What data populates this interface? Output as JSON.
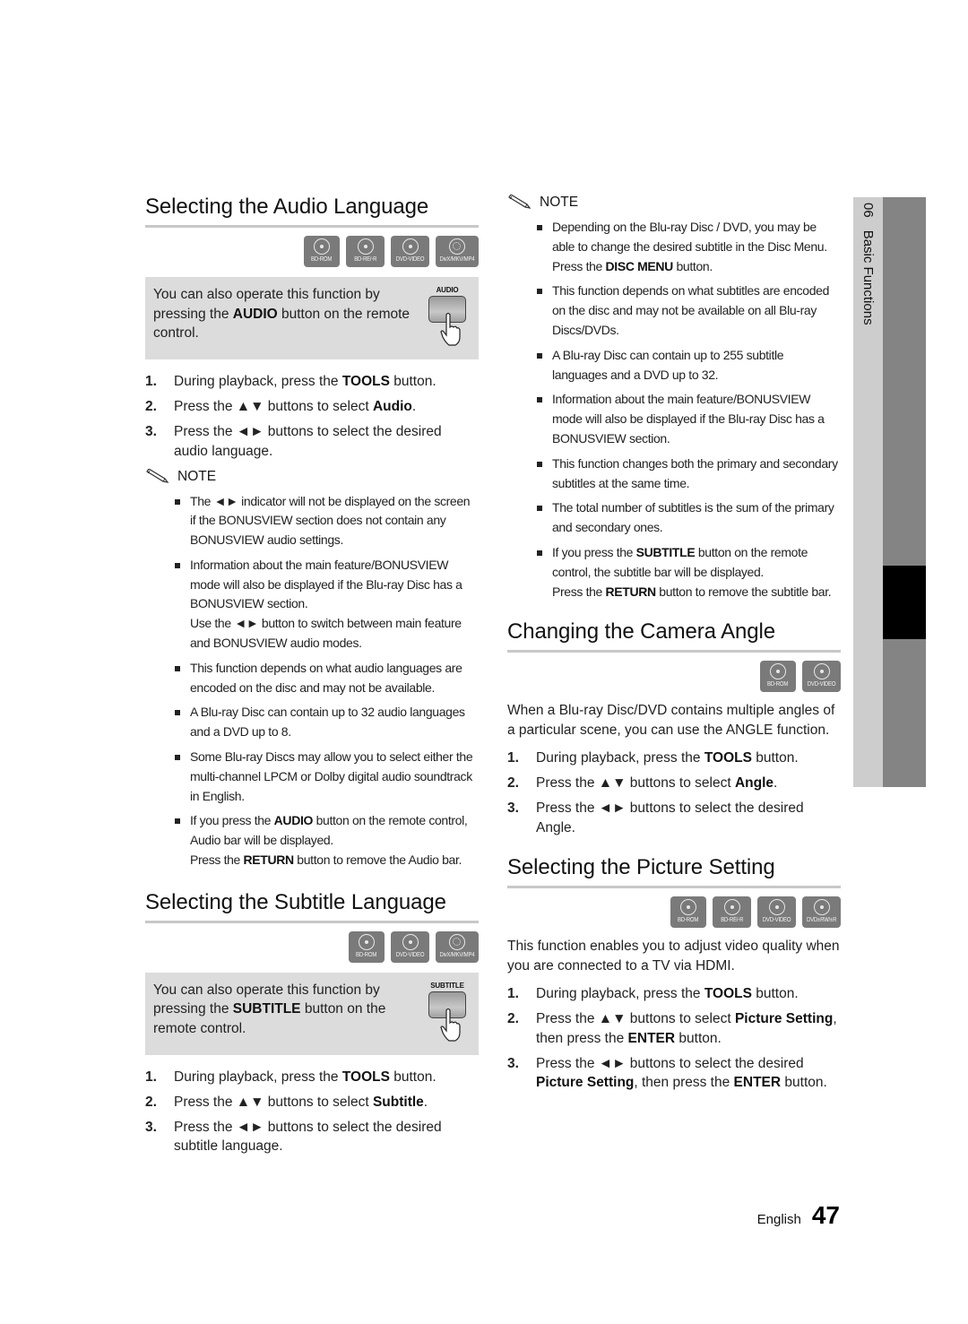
{
  "side_tab": {
    "chapter_number": "06",
    "chapter_title": "Basic Functions"
  },
  "footer": {
    "language": "English",
    "page_number": "47"
  },
  "icons": {
    "note": "pencil-icon",
    "disc": "disc-icon",
    "divx": "film-reel-icon",
    "remote_button": "remote-button-icon",
    "hand": "pointing-hand-icon"
  },
  "colors": {
    "badge_bg": "#7a7a7a",
    "tip_box_bg": "#dcdcdc",
    "rule": "#c8c8c8",
    "side_tab_light": "#cdcdcd",
    "side_tab_dark": "#848484",
    "side_tab_marker": "#000000"
  },
  "audio": {
    "title": "Selecting the Audio Language",
    "badges": [
      "BD-ROM",
      "BD-RE/-R",
      "DVD-VIDEO",
      "DivX/MKV/MP4"
    ],
    "tip": {
      "pre": "You can also operate this function by pressing the ",
      "bold": "AUDIO",
      "post": " button on the remote control.",
      "remote_label": "AUDIO"
    },
    "steps": [
      {
        "num": "1.",
        "pre": "During playback, press the ",
        "bold": "TOOLS",
        "post": " button."
      },
      {
        "num": "2.",
        "pre": "Press the ▲▼ buttons to select ",
        "bold": "Audio",
        "post": "."
      },
      {
        "num": "3.",
        "pre": "Press the ◄► buttons to select the desired audio language.",
        "bold": "",
        "post": ""
      }
    ],
    "note_label": "NOTE",
    "notes": [
      "The ◄► indicator will not be displayed on the screen if the BONUSVIEW section does not contain any BONUSVIEW audio settings.",
      "Information about the main feature/BONUSVIEW mode will also be displayed if the Blu-ray Disc has a BONUSVIEW section.",
      "This function depends on what audio languages are encoded on the disc and may not be available.",
      "A Blu-ray Disc can contain up to 32 audio languages and a DVD up to 8.",
      "Some Blu-ray Discs may allow you to select either the multi-channel LPCM or Dolby digital audio soundtrack in English."
    ],
    "note2_extra": "Use the ◄► button to switch between main feature and BONUSVIEW audio modes.",
    "note_last": {
      "pre": "If you press the ",
      "bold": "AUDIO",
      "post": " button on the remote control, Audio bar will be displayed.",
      "line2_pre": "Press the ",
      "line2_bold": "RETURN",
      "line2_post": " button to remove the Audio bar."
    }
  },
  "subtitle": {
    "title": "Selecting the Subtitle Language",
    "badges": [
      "BD-ROM",
      "DVD-VIDEO",
      "DivX/MKV/MP4"
    ],
    "tip": {
      "pre": "You can also operate this function by pressing the ",
      "bold": "SUBTITLE",
      "post": " button on the remote control.",
      "remote_label": "SUBTITLE"
    },
    "steps": [
      {
        "num": "1.",
        "pre": "During playback, press the ",
        "bold": "TOOLS",
        "post": " button."
      },
      {
        "num": "2.",
        "pre": "Press the ▲▼ buttons to select ",
        "bold": "Subtitle",
        "post": "."
      },
      {
        "num": "3.",
        "pre": "Press the ◄► buttons to select the desired subtitle language.",
        "bold": "",
        "post": ""
      }
    ],
    "note_label": "NOTE",
    "note_first": {
      "pre": "Depending on the Blu-ray Disc / DVD, you may be able to change the desired subtitle in the Disc Menu. Press the ",
      "bold": "DISC MENU",
      "post": " button."
    },
    "notes": [
      "This function depends on what subtitles are encoded on the disc and may not be available on all Blu-ray Discs/DVDs.",
      "A Blu-ray Disc can contain up to 255 subtitle languages and a DVD up to 32.",
      "Information about the main feature/BONUSVIEW mode will also be displayed if the Blu-ray Disc has a BONUSVIEW section.",
      "This function changes both the primary and secondary subtitles at the same time.",
      "The total number of subtitles is the sum of the primary and secondary ones."
    ],
    "note_last": {
      "pre": "If you press the ",
      "bold": "SUBTITLE",
      "post": " button on the remote control, the subtitle bar will be displayed.",
      "line2_pre": "Press the ",
      "line2_bold": "RETURN",
      "line2_post": " button to remove the subtitle bar."
    }
  },
  "angle": {
    "title": "Changing the Camera Angle",
    "badges": [
      "BD-ROM",
      "DVD-VIDEO"
    ],
    "intro": "When a Blu-ray Disc/DVD contains multiple angles of a particular scene, you can use the ANGLE function.",
    "steps": [
      {
        "num": "1.",
        "pre": "During playback, press the ",
        "bold": "TOOLS",
        "post": " button."
      },
      {
        "num": "2.",
        "pre": "Press the ▲▼ buttons to select ",
        "bold": "Angle",
        "post": "."
      },
      {
        "num": "3.",
        "pre": "Press the ◄► buttons to select the desired Angle.",
        "bold": "",
        "post": ""
      }
    ]
  },
  "picture": {
    "title": "Selecting the Picture Setting",
    "badges": [
      "BD-ROM",
      "BD-RE/-R",
      "DVD-VIDEO",
      "DVD±RW/±R"
    ],
    "intro": "This function enables you to adjust video quality when you are connected to a TV via HDMI.",
    "steps": [
      {
        "num": "1.",
        "pre": "During playback, press the ",
        "bold": "TOOLS",
        "post": " button."
      },
      {
        "num": "2.",
        "pre": "Press the ▲▼ buttons to select ",
        "bold": "Picture Setting",
        "post": ", then press the ",
        "bold2": "ENTER",
        "post2": " button."
      },
      {
        "num": "3.",
        "pre": "Press the ◄► buttons to select the desired ",
        "bold": "Picture Setting",
        "post": ", then press the ",
        "bold2": "ENTER",
        "post2": " button."
      }
    ]
  }
}
